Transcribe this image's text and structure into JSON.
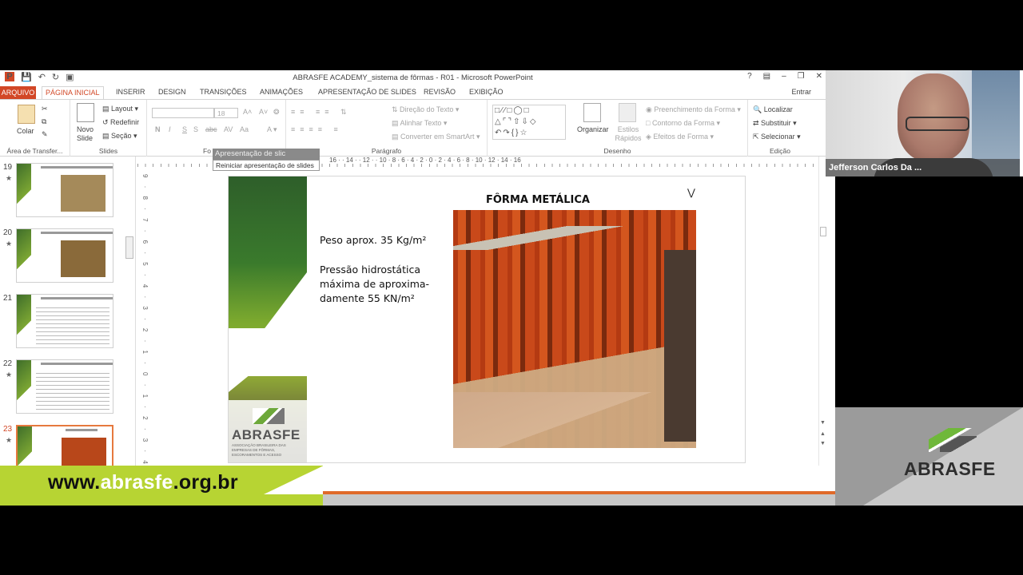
{
  "app": {
    "window_title": "ABRASFE ACADEMY_sistema de fôrmas - R01 - Microsoft PowerPoint",
    "help": "?",
    "signin": "Entrar"
  },
  "tabs": [
    "ARQUIVO",
    "PÁGINA INICIAL",
    "INSERIR",
    "DESIGN",
    "TRANSIÇÕES",
    "ANIMAÇÕES",
    "APRESENTAÇÃO DE SLIDES",
    "REVISÃO",
    "EXIBIÇÃO"
  ],
  "ribbon": {
    "clipboard": {
      "paste": "Colar",
      "label": "Área de Transfer..."
    },
    "slides": {
      "new_slide": "Novo Slide",
      "layout": "Layout",
      "reset": "Redefinir",
      "section": "Seção",
      "label": "Slides"
    },
    "font": {
      "size": "18",
      "bold": "N",
      "italic": "I",
      "underline": "S",
      "strike": "S",
      "spacing": "abc",
      "case": "AV",
      "shrink": "Aa",
      "label": "Fo"
    },
    "paragraph": {
      "direction": "Direção do Texto",
      "align": "Alinhar Texto",
      "smartart": "Converter em SmartArt",
      "label": "Parágrafo"
    },
    "drawing": {
      "arrange": "Organizar",
      "styles": "Estilos Rápidos",
      "fill": "Preenchimento da Forma",
      "outline": "Contorno da Forma",
      "effects": "Efeitos de Forma",
      "label": "Desenho"
    },
    "editing": {
      "find": "Localizar",
      "replace": "Substituir",
      "select": "Selecionar",
      "label": "Edição"
    }
  },
  "tooltip": {
    "head": "Apresentação de slic",
    "text": "Reiniciar apresentação de slides"
  },
  "thumbnails": [
    {
      "num": "19",
      "star": "★",
      "selected": false
    },
    {
      "num": "20",
      "star": "★",
      "selected": false
    },
    {
      "num": "21",
      "star": "",
      "selected": false
    },
    {
      "num": "22",
      "star": "★",
      "selected": false
    },
    {
      "num": "23",
      "star": "★",
      "selected": true
    }
  ],
  "ruler": "16 · · 14 · · 12 · · 10 · 8 · 6 · 4 · 2 · 0 · 2 · 4 · 6 · 8 · 10 · 12 · 14 · 16",
  "vruler": "9 · 8 · 7 · 6 · 5 · 4 · 3 · 2 · 1 · 0 · 1 · 2 · 3 · 4 · 5 · 6 · 7 · 8 · 9",
  "slide": {
    "heading": "FÔRMA METÁLICA",
    "weight": "Peso aprox. 35 Kg/m²",
    "pressure": "Pressão hidrostática\nmáxima de aproxima-\ndamente  55 KN/m²",
    "logo": "ABRASFE",
    "logo_sub": "ASSOCIAÇÃO BRASILEIRA DAS EMPRESAS DE FÔRMAS, ESCORAMENTOS E ACESSO"
  },
  "webcam": {
    "name": "Jefferson Carlos Da ..."
  },
  "banner": {
    "url_pre": "www.",
    "url_hl": "abrasfe",
    "url_post": ".org.br",
    "brand": "ABRASFE"
  },
  "colors": {
    "accent": "#d24726",
    "banner_green": "#b7d433",
    "brand_green": "#6fb83a"
  }
}
